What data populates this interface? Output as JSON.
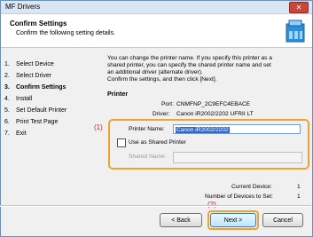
{
  "window": {
    "title": "MF Drivers",
    "close": "✕"
  },
  "header": {
    "title": "Confirm Settings",
    "subtitle": "Confirm the following setting details."
  },
  "steps": [
    {
      "num": "1.",
      "label": "Select Device"
    },
    {
      "num": "2.",
      "label": "Select Driver"
    },
    {
      "num": "3.",
      "label": "Confirm Settings"
    },
    {
      "num": "4.",
      "label": "Install"
    },
    {
      "num": "5.",
      "label": "Set Default Printer"
    },
    {
      "num": "6.",
      "label": "Print Test Page"
    },
    {
      "num": "7.",
      "label": "Exit"
    }
  ],
  "description": {
    "line1": "You can change the printer name. If you specify this printer as a",
    "line2": "shared printer, you can specify the shared printer name and set",
    "line3": "an additional driver (alternate driver).",
    "line4": "Confirm the settings, and then click [Next]."
  },
  "printer": {
    "heading": "Printer",
    "port_label": "Port:",
    "port_value": "CNMFNP_2C9EFC4EBACE",
    "driver_label": "Driver:",
    "driver_value": "Canon iR2002/2202 UFRII LT",
    "name_label": "Printer Name:",
    "name_value": "Canon iR2002/2202",
    "shared_label": "Use as Shared Printer",
    "shared_name_label": "Shared Name:"
  },
  "annotations": {
    "a1": "(1)",
    "a2": "(2)"
  },
  "status": {
    "current_label": "Current Device:",
    "current_value": "1",
    "count_label": "Number of Devices to Set:",
    "count_value": "1"
  },
  "buttons": {
    "back": "< Back",
    "next": "Next >",
    "cancel": "Cancel"
  },
  "colors": {
    "accent": "#f0a230",
    "annotation": "#c4201a",
    "selection": "#3168c6"
  }
}
